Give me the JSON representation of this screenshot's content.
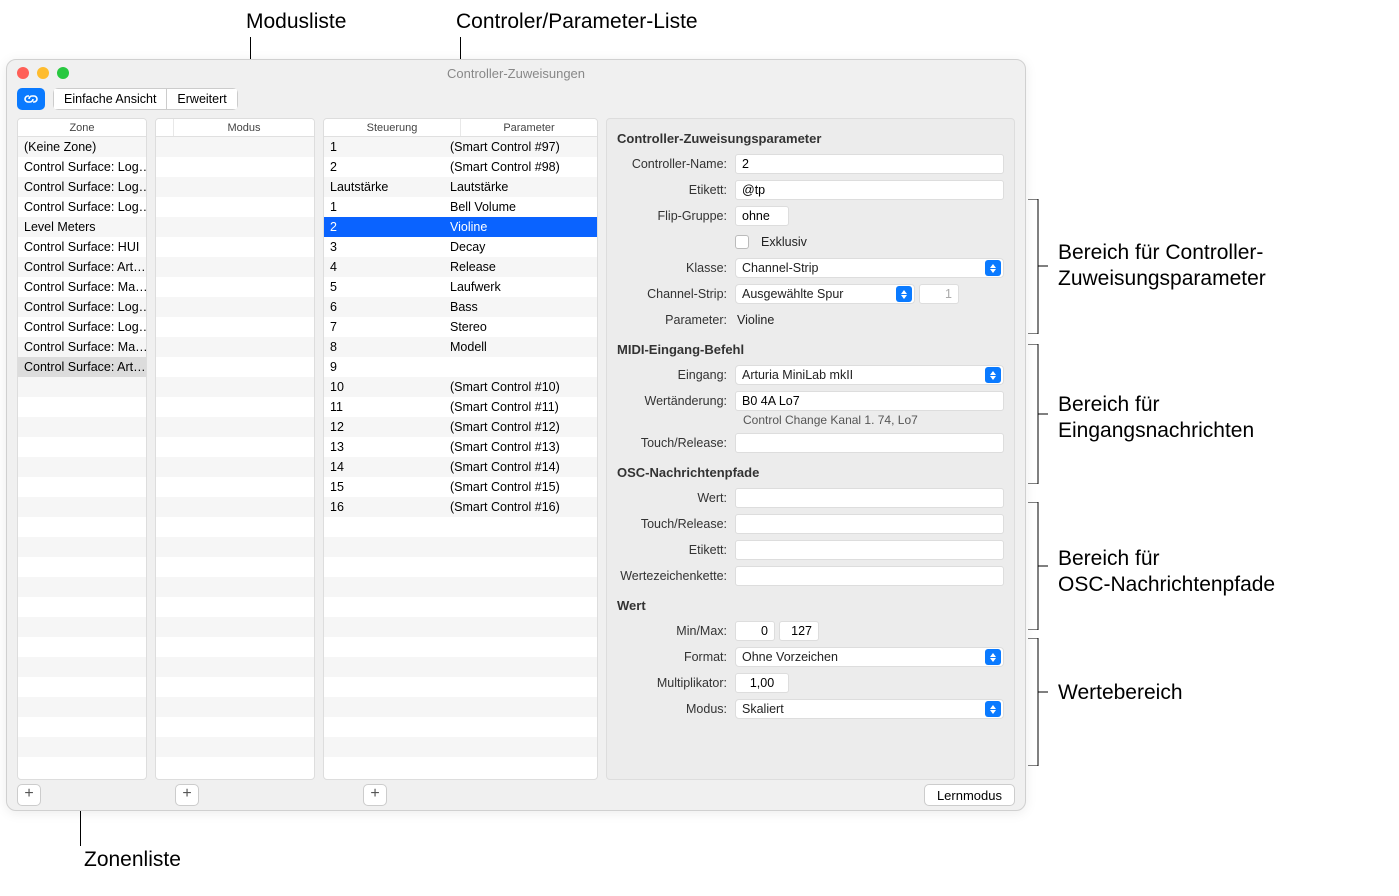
{
  "callouts": {
    "top_mode": "Modusliste",
    "top_params": "Controler/Parameter-Liste",
    "bottom_zone": "Zonenliste",
    "right_assign": "Bereich für Controller-\nZuweisungsparameter",
    "right_input": "Bereich für\nEingangsnachrichten",
    "right_osc": "Bereich für\nOSC-Nachrichtenpfade",
    "right_value": "Wertebereich"
  },
  "window": {
    "title": "Controller-Zuweisungen",
    "view_simple": "Einfache Ansicht",
    "view_expert": "Erweitert",
    "learn_button": "Lernmodus"
  },
  "headers": {
    "zone": "Zone",
    "mode": "Modus",
    "control": "Steuerung",
    "parameter": "Parameter"
  },
  "zones": [
    "(Keine Zone)",
    "Control Surface: Log…",
    "Control Surface: Log…",
    "Control Surface: Log…",
    "Level Meters",
    "Control Surface: HUI",
    "Control Surface: Art…",
    "Control Surface: Ma…",
    "Control Surface: Log…",
    "Control Surface: Log…",
    "Control Surface: Ma…",
    "Control Surface: Art…"
  ],
  "zone_selected_index": 11,
  "modes": [],
  "params": [
    {
      "c": "1",
      "p": "(Smart Control #97)"
    },
    {
      "c": "2",
      "p": "(Smart Control #98)"
    },
    {
      "c": "Lautstärke",
      "p": "Lautstärke"
    },
    {
      "c": "1",
      "p": "Bell Volume"
    },
    {
      "c": "2",
      "p": "Violine"
    },
    {
      "c": "3",
      "p": "Decay"
    },
    {
      "c": "4",
      "p": "Release"
    },
    {
      "c": "5",
      "p": "Laufwerk"
    },
    {
      "c": "6",
      "p": "Bass"
    },
    {
      "c": "7",
      "p": "Stereo"
    },
    {
      "c": "8",
      "p": "Modell"
    },
    {
      "c": "9",
      "p": ""
    },
    {
      "c": "10",
      "p": "(Smart Control #10)"
    },
    {
      "c": "11",
      "p": "(Smart Control #11)"
    },
    {
      "c": "12",
      "p": "(Smart Control #12)"
    },
    {
      "c": "13",
      "p": "(Smart Control #13)"
    },
    {
      "c": "14",
      "p": "(Smart Control #14)"
    },
    {
      "c": "15",
      "p": "(Smart Control #15)"
    },
    {
      "c": "16",
      "p": "(Smart Control #16)"
    }
  ],
  "param_selected_index": 4,
  "inspector": {
    "section_assign": "Controller-Zuweisungsparameter",
    "controller_name_label": "Controller-Name:",
    "controller_name": "2",
    "etikett_label": "Etikett:",
    "etikett": "@tp",
    "flip_label": "Flip-Gruppe:",
    "flip": "ohne",
    "exclusive_label": "Exklusiv",
    "klasse_label": "Klasse:",
    "klasse": "Channel-Strip",
    "channelstrip_label": "Channel-Strip:",
    "channelstrip": "Ausgewählte Spur",
    "channelstrip_num": "1",
    "parameter_label": "Parameter:",
    "parameter": "Violine",
    "section_midi": "MIDI-Eingang-Befehl",
    "eingang_label": "Eingang:",
    "eingang": "Arturia MiniLab mkII",
    "wertanderung_label": "Wertänderung:",
    "wertanderung": "B0 4A Lo7",
    "wert_sub": "Control Change Kanal 1. 74, Lo7",
    "touchrelease_label": "Touch/Release:",
    "touchrelease": "",
    "section_osc": "OSC-Nachrichtenpfade",
    "osc_wert_label": "Wert:",
    "osc_touch_label": "Touch/Release:",
    "osc_etikett_label": "Etikett:",
    "osc_string_label": "Wertezeichenkette:",
    "section_value": "Wert",
    "minmax_label": "Min/Max:",
    "min": "0",
    "max": "127",
    "format_label": "Format:",
    "format": "Ohne Vorzeichen",
    "multiplikator_label": "Multiplikator:",
    "multiplikator": "1,00",
    "modus_label": "Modus:",
    "modus": "Skaliert"
  }
}
